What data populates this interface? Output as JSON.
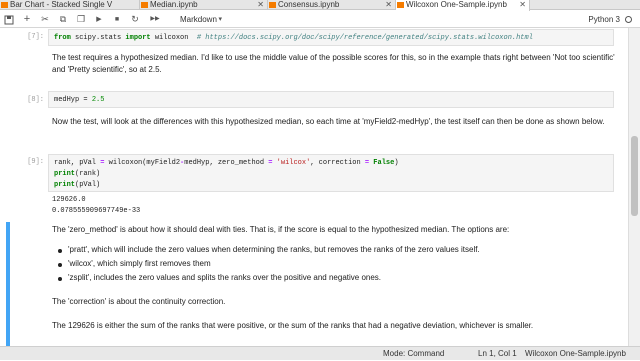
{
  "tabs": [
    {
      "label": "Bar Chart - Stacked Single V",
      "active": false
    },
    {
      "label": "Median.ipynb",
      "active": false
    },
    {
      "label": "Consensus.ipynb",
      "active": false
    },
    {
      "label": "Wilcoxon One-Sample.ipynb",
      "active": true
    }
  ],
  "toolbar": {
    "save": "+",
    "cut": "✂",
    "copy": "⧉",
    "paste": "❐",
    "run": "▶",
    "stop": "■",
    "restart": "↻",
    "fastforward": "▶▶",
    "cell_type": "Markdown",
    "kernel": "Python 3"
  },
  "cells": {
    "c7": {
      "prompt": "[7]:",
      "kw1": "from",
      "mod": " scipy.stats ",
      "kw2": "import",
      "name": " wilcoxon  ",
      "comment": "# https://docs.scipy.org/doc/scipy/reference/generated/scipy.stats.wilcoxon.html"
    },
    "md1": "The test requires a hypothesized median. I'd like to use the middle value of the possible scores for this, so in the example thats right between 'Not too scientific' and 'Pretty scientific', so at 2.5.",
    "c8": {
      "prompt": "[8]:",
      "code": "medHyp = ",
      "num": "2.5"
    },
    "md2": "Now the test, will look at the differences with this hypothesized median, so each time at 'myField2-medHyp', the test itself can then be done as shown below.",
    "c9": {
      "prompt": "[9]:",
      "l1a": "rank, pVal ",
      "l1b": "=",
      "l1c": " wilcoxon(myField2",
      "l1d": "-",
      "l1e": "medHyp, zero_method ",
      "l1f": "=",
      "l1g": " ",
      "l1h": "'wilcox'",
      "l1i": ", correction ",
      "l1j": "=",
      "l1k": " ",
      "l1l": "False",
      "l1m": ")",
      "l2a": "print",
      "l2b": "(rank)",
      "l3a": "print",
      "l3b": "(pVal)"
    },
    "out9": {
      "line1": "129626.0",
      "line2": "0.078555909697749e-33"
    },
    "md3": "The 'zero_method' is about how it should deal with ties. That is, if the score is equal to the hypothesized median. The options are:",
    "bullets": [
      "'pratt', which will include the zero values when determining the ranks, but removes the ranks of the zero values itself.",
      "'wilcox', which simply first removes them",
      "'zsplit', includes the zero values and splits the ranks over the positive and negative ones."
    ],
    "md4": "The 'correction' is about the continuity correction.",
    "md5": "The 129626 is either the sum of the ranks that were positive, or the sum of the ranks that had a negative deviation, whichever is smaller."
  },
  "status": {
    "mode": "Mode: Command",
    "position": "Ln 1, Col 1",
    "file": "Wilcoxon One-Sample.ipynb"
  }
}
